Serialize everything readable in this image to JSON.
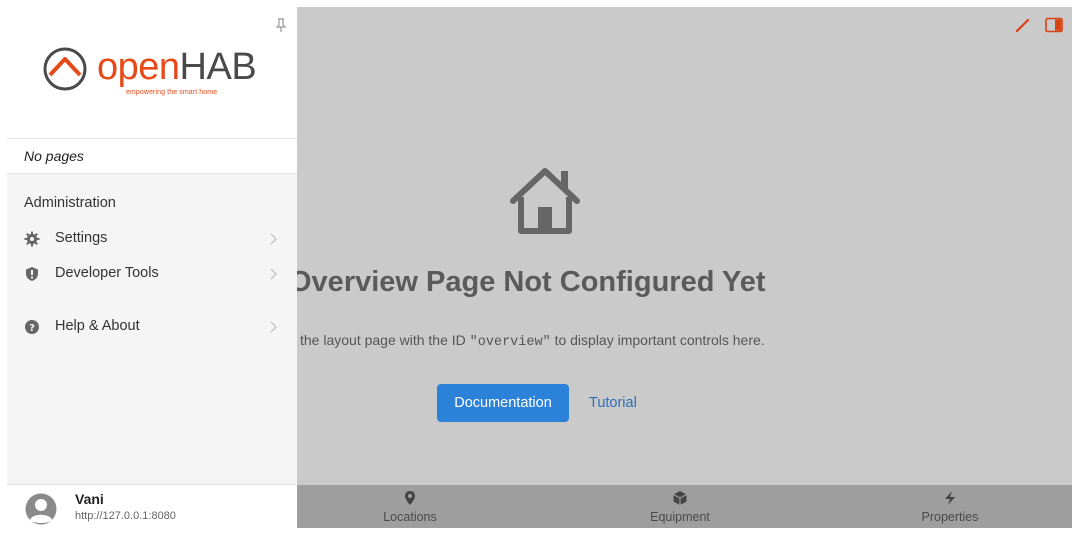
{
  "sidebar": {
    "logo": {
      "open": "open",
      "hab": "HAB",
      "tagline": "empowering the smart home"
    },
    "no_pages": "No pages",
    "admin_title": "Administration",
    "items": [
      {
        "label": "Settings",
        "icon": "gear-icon"
      },
      {
        "label": "Developer Tools",
        "icon": "shield-icon"
      },
      {
        "label": "Help & About",
        "icon": "help-icon"
      }
    ],
    "user": {
      "name": "Vani",
      "url": "http://127.0.0.1:8080"
    }
  },
  "main": {
    "title": "Overview Page Not Configured Yet",
    "desc_before": "the layout page with the ID ",
    "desc_code": "\"overview\"",
    "desc_after": " to display important controls here.",
    "doc_button": "Documentation",
    "tutorial_link": "Tutorial"
  },
  "tabs": [
    {
      "label": "Locations",
      "icon": "map-pin-icon"
    },
    {
      "label": "Equipment",
      "icon": "cube-icon"
    },
    {
      "label": "Properties",
      "icon": "bolt-icon"
    }
  ],
  "colors": {
    "brand": "#e64a19",
    "primary_button": "#2c82d8",
    "overlay": "#cacaca",
    "tabbar": "#9e9e9e"
  }
}
